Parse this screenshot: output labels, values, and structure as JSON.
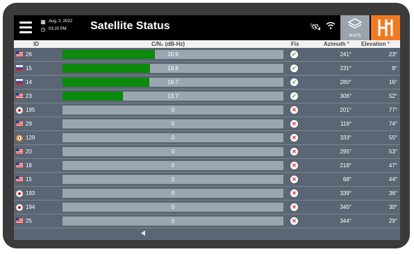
{
  "header": {
    "date": "Aug. 2, 2022",
    "time": "03:20 PM",
    "title": "Satellite Status",
    "maps_label": "MAPS"
  },
  "columns": {
    "id": "ID",
    "cn0": "C/N₀ (dB-Hz)",
    "fix": "Fix",
    "azimuth": "Azimuth °",
    "elevation": "Elevation °"
  },
  "colors": {
    "signal_bar": "#0c8a0c",
    "logo_bg": "#f07a22",
    "fix_ok": "#2e8b2e",
    "fix_no": "#dd2222"
  },
  "satellites": [
    {
      "flag": "us",
      "id": "26",
      "cn0": "20.9",
      "fix": true,
      "azimuth": "241°",
      "elevation": "23°"
    },
    {
      "flag": "ru",
      "id": "15",
      "cn0": "19.8",
      "fix": true,
      "azimuth": "231°",
      "elevation": "8°"
    },
    {
      "flag": "ru",
      "id": "14",
      "cn0": "19.7",
      "fix": true,
      "azimuth": "280°",
      "elevation": "16°"
    },
    {
      "flag": "us",
      "id": "23",
      "cn0": "13.7",
      "fix": true,
      "azimuth": "306°",
      "elevation": "52°"
    },
    {
      "flag": "jp",
      "id": "195",
      "cn0": "0",
      "fix": false,
      "azimuth": "201°",
      "elevation": "77°"
    },
    {
      "flag": "us",
      "id": "29",
      "cn0": "0",
      "fix": false,
      "azimuth": "116°",
      "elevation": "74°"
    },
    {
      "flag": "in",
      "id": "129",
      "cn0": "0",
      "fix": false,
      "azimuth": "333°",
      "elevation": "55°"
    },
    {
      "flag": "us",
      "id": "20",
      "cn0": "0",
      "fix": false,
      "azimuth": "295°",
      "elevation": "53°"
    },
    {
      "flag": "us",
      "id": "18",
      "cn0": "0",
      "fix": false,
      "azimuth": "218°",
      "elevation": "47°"
    },
    {
      "flag": "us",
      "id": "15",
      "cn0": "0",
      "fix": false,
      "azimuth": "68°",
      "elevation": "44°"
    },
    {
      "flag": "jp",
      "id": "193",
      "cn0": "0",
      "fix": false,
      "azimuth": "339°",
      "elevation": "36°"
    },
    {
      "flag": "jp",
      "id": "194",
      "cn0": "0",
      "fix": false,
      "azimuth": "345°",
      "elevation": "30°"
    },
    {
      "flag": "us",
      "id": "25",
      "cn0": "0",
      "fix": false,
      "azimuth": "344°",
      "elevation": "29°"
    }
  ]
}
